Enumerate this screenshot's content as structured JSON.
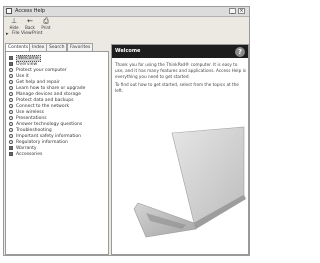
{
  "window": {
    "title": "Access Help",
    "minimize": "_",
    "close": "×"
  },
  "toolbar": {
    "buttons": [
      {
        "icon": "hide-icon",
        "label": "Hide"
      },
      {
        "icon": "back-icon",
        "label": "Back"
      },
      {
        "icon": "print-icon",
        "label": "Print"
      }
    ]
  },
  "menubar": {
    "items": [
      "File",
      "View",
      "Print"
    ]
  },
  "tabs": [
    "Contents",
    "Index",
    "Search",
    "Favorites"
  ],
  "nav": {
    "items": [
      "Welcome",
      "Overview",
      "Protect your computer",
      "Use it",
      "Get help and repair",
      "Learn how to share or upgrade",
      "Manage devices and storage",
      "Protect data and backups",
      "Connect to the network",
      "Use wireless",
      "Presentations",
      "Answer technology questions",
      "Troubleshooting",
      "Important safety information",
      "Regulatory information",
      "Warranty",
      "Accessories"
    ]
  },
  "content": {
    "title": "Welcome",
    "help_glyph": "?",
    "paragraph1": "Thank you for using the ThinkPad® computer. It is easy to use, and it has many features and applications. Access Help is everything you need to get started.",
    "paragraph2": "To find out how to get started, select from the topics at the left."
  }
}
